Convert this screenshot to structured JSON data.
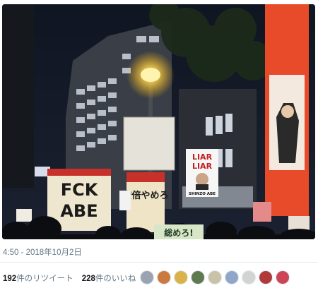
{
  "tweet": {
    "image": {
      "signs": {
        "fck_abe_line1": "FCK",
        "fck_abe_line2": "ABE",
        "liar_line1": "LIAR",
        "liar_line2": "LIAR",
        "liar_caption": "SHINZO ABE",
        "vertical_sign": "安倍やめろ",
        "bottom_sign": "総めろ!"
      }
    },
    "timestamp": "4:50 - 2018年10月2日",
    "retweets": {
      "count": "192",
      "label": "件のリツイート"
    },
    "likes": {
      "count": "228",
      "label": "件のいいね"
    },
    "avatar_colors": [
      "#9aa4b1",
      "#c97a3c",
      "#d9b24a",
      "#5f7a4e",
      "#c9c2a8",
      "#8fa6c9",
      "#d3d3d3",
      "#b03a3a",
      "#cc4455"
    ]
  }
}
